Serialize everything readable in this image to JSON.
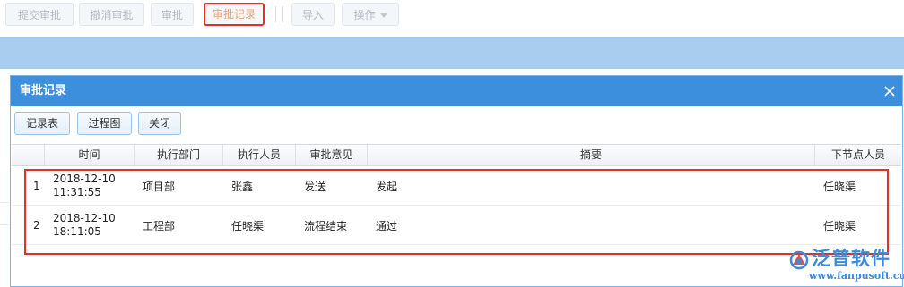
{
  "toolbar": {
    "buttons": [
      "提交审批",
      "撤消审批",
      "审批",
      "审批记录"
    ],
    "import_label": "导入",
    "operate_label": "操作"
  },
  "dialog": {
    "title": "审批记录",
    "buttons": [
      "记录表",
      "过程图",
      "关闭"
    ],
    "columns": [
      "时间",
      "执行部门",
      "执行人员",
      "审批意见",
      "摘要",
      "下节点人员"
    ],
    "rows": [
      {
        "num": "1",
        "date": "2018-12-10",
        "time": "11:31:55",
        "dept": "项目部",
        "person": "张鑫",
        "opinion": "发送",
        "summary": "发起",
        "next": "任晓渠"
      },
      {
        "num": "2",
        "date": "2018-12-10",
        "time": "18:11:05",
        "dept": "工程部",
        "person": "任晓渠",
        "opinion": "流程结束",
        "summary": "通过",
        "next": "任晓渠"
      }
    ]
  },
  "watermark": {
    "brand": "泛普软件",
    "url": "www.fanpusoft.com",
    "color": "#3a8ad8"
  },
  "colors": {
    "header_blue": "#3c8fdd",
    "highlight_red": "#e0302c",
    "band_blue": "#a9cdef"
  }
}
